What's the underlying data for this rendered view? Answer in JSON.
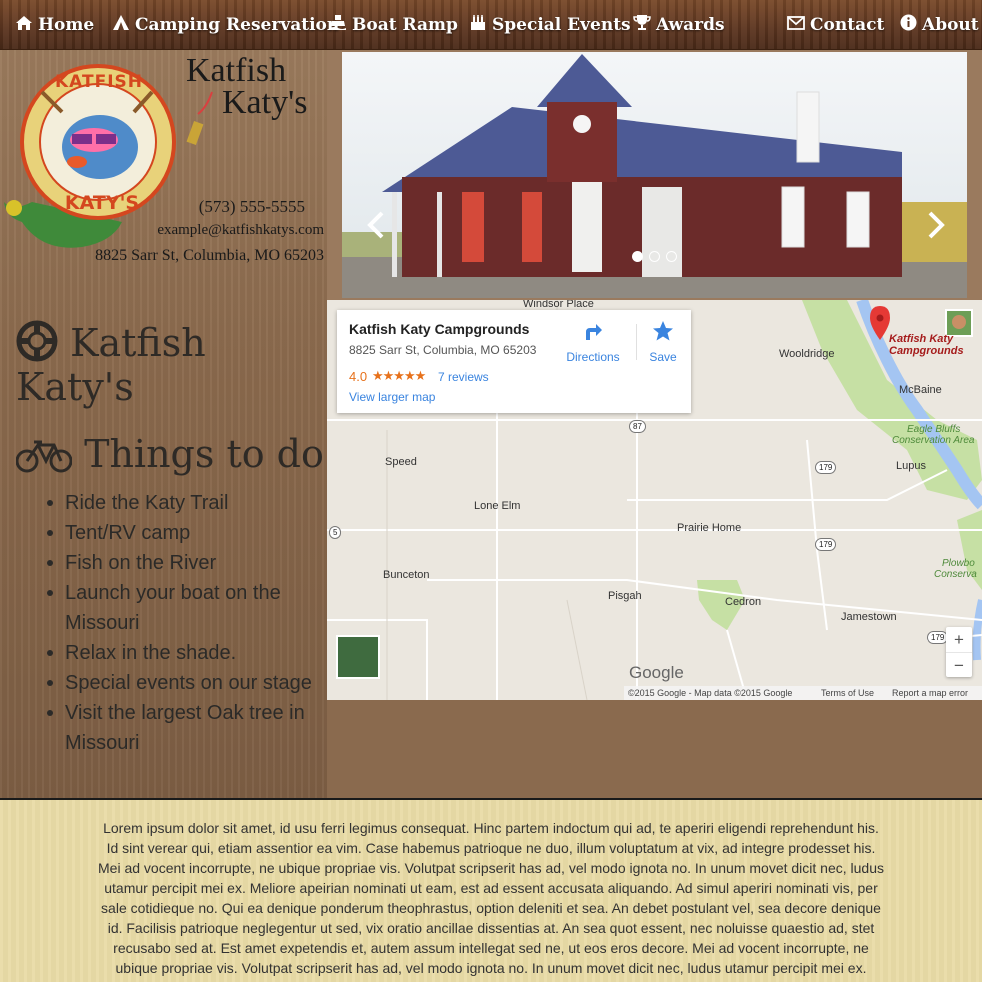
{
  "nav": {
    "items": [
      {
        "label": "Home",
        "icon": "home-icon"
      },
      {
        "label": "Camping Reservation",
        "icon": "tent-icon"
      },
      {
        "label": "Boat Ramp",
        "icon": "ship-icon"
      },
      {
        "label": "Special Events",
        "icon": "cake-icon"
      },
      {
        "label": "Awards",
        "icon": "trophy-icon"
      },
      {
        "label": "Contact",
        "icon": "envelope-icon"
      },
      {
        "label": "About",
        "icon": "info-icon"
      }
    ]
  },
  "brand": {
    "name_line1": "Katfish",
    "name_line2": "Katy's",
    "logo_text_top": "KATFISH",
    "logo_text_bottom": "KATY'S",
    "phone": "(573) 555-5555",
    "email": "example@katfishkatys.com",
    "address": "8825 Sarr St, Columbia, MO 65203"
  },
  "sections": {
    "katy_title": "Katfish Katy's",
    "katy_icon": "life-ring-icon",
    "things_title": "Things to do",
    "things_icon": "bicycle-icon",
    "things": [
      "Ride the Katy Trail",
      "Tent/RV camp",
      "Fish on the River",
      "Launch your boat on the Missouri",
      "Relax in the shade.",
      "Special events on our stage",
      "Visit the largest Oak tree in Missouri"
    ]
  },
  "carousel": {
    "prev_icon": "chevron-left-icon",
    "next_icon": "chevron-right-icon",
    "slide_count": 3,
    "active_slide": 1
  },
  "map": {
    "place_name": "Katfish Katy Campgrounds",
    "address": "8825 Sarr St, Columbia, MO 65203",
    "rating": "4.0",
    "stars": "★★★★★",
    "reviews": "7 reviews",
    "view_larger": "View larger map",
    "directions": "Directions",
    "save": "Save",
    "marker_label_line1": "Katfish Katy",
    "marker_label_line2": "Campgrounds",
    "labels": {
      "windsor_place": "Windsor Place",
      "wooldridge": "Wooldridge",
      "mcbaine": "McBaine",
      "eagle_bluffs_1": "Eagle Bluffs",
      "eagle_bluffs_2": "Conservation Area",
      "speed": "Speed",
      "lupus": "Lupus",
      "lone_elm": "Lone Elm",
      "prairie_home": "Prairie Home",
      "bunceton": "Bunceton",
      "pisgah": "Pisgah",
      "cedron": "Cedron",
      "jamestown": "Jamestown",
      "plowboy_1": "Plowbo",
      "plowboy_2": "Conserva",
      "google": "Google"
    },
    "routes": {
      "r87": "87",
      "r179a": "179",
      "r179b": "179",
      "r179c": "179",
      "r5": "5"
    },
    "zoom_in": "+",
    "zoom_out": "−",
    "attribution": "©2015 Google - Map data ©2015 Google",
    "terms": "Terms of Use",
    "report": "Report a map error",
    "colors": {
      "river": "#a4c5f2",
      "park": "#c6e0a4",
      "marker": "#e53935",
      "link": "#3a84df"
    }
  },
  "footer": {
    "text": "Lorem ipsum dolor sit amet, id usu ferri legimus consequat. Hinc partem indoctum qui ad, te aperiri eligendi reprehendunt his. Id sint verear qui, etiam assentior ea vim. Case habemus patrioque ne duo, illum voluptatum at vix, ad integre prodesset his. Mei ad vocent incorrupte, ne ubique propriae vis. Volutpat scripserit has ad, vel modo ignota no. In unum movet dicit nec, ludus utamur percipit mei ex. Meliore apeirian nominati ut eam, est ad essent accusata aliquando. Ad simul aperiri nominati vis, per sale cotidieque no. Qui ea denique ponderum theophrastus, option deleniti et sea. An debet postulant vel, sea decore denique id. Facilisis patrioque neglegentur ut sed, vix oratio ancillae dissentias at. An sea quot essent, nec noluisse quaestio ad, stet recusabo sed at. Est amet expetendis et, autem assum intellegat sed ne, ut eos eros decore. Mei ad vocent incorrupte, ne ubique propriae vis. Volutpat scripserit has ad, vel modo ignota no. In unum movet dicit nec, ludus utamur percipit mei ex. Meliore apeirian nominati ut eam, est ad essent accusata aliquando. Ad simul aperiri"
  }
}
